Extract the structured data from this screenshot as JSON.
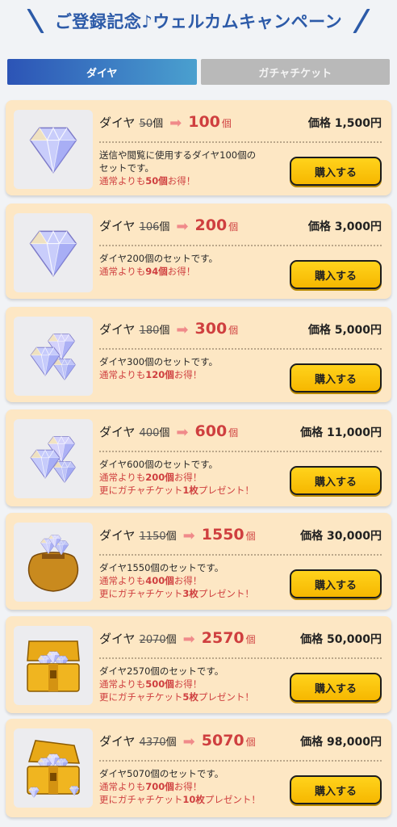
{
  "banner": {
    "title": "ご登録記念♪ウェルカムキャンペーン"
  },
  "tabs": [
    {
      "label": "ダイヤ",
      "active": true
    },
    {
      "label": "ガチャチケット",
      "active": false
    }
  ],
  "colors": {
    "brand_blue": "#2c5aa8",
    "card_bg": "#fde7c4",
    "accent_red": "#cf3f3f",
    "button_yellow": "#ffc80a"
  },
  "products": [
    {
      "item_label": "ダイヤ",
      "old_amount": "50",
      "old_unit": "個",
      "new_amount": "100",
      "new_unit": "個",
      "price": "価格 1,500円",
      "desc_lines": [
        "送信や閲覧に使用するダイヤ100個の",
        "セットです。"
      ],
      "discount_prefix": "通常よりも",
      "discount_value": "50個",
      "discount_suffix": "お得！",
      "bonus_prefix": "",
      "bonus_value": "",
      "bonus_suffix": "",
      "button_label": "購入する",
      "image_icon": "diamond-single-icon"
    },
    {
      "item_label": "ダイヤ",
      "old_amount": "106",
      "old_unit": "個",
      "new_amount": "200",
      "new_unit": "個",
      "price": "価格 3,000円",
      "desc_lines": [
        "ダイヤ200個のセットです。"
      ],
      "discount_prefix": "通常よりも",
      "discount_value": "94個",
      "discount_suffix": "お得！",
      "bonus_prefix": "",
      "bonus_value": "",
      "bonus_suffix": "",
      "button_label": "購入する",
      "image_icon": "diamond-single-icon"
    },
    {
      "item_label": "ダイヤ",
      "old_amount": "180",
      "old_unit": "個",
      "new_amount": "300",
      "new_unit": "個",
      "price": "価格 5,000円",
      "desc_lines": [
        "ダイヤ300個のセットです。"
      ],
      "discount_prefix": "通常よりも",
      "discount_value": "120個",
      "discount_suffix": "お得！",
      "bonus_prefix": "",
      "bonus_value": "",
      "bonus_suffix": "",
      "button_label": "購入する",
      "image_icon": "diamond-pile-icon"
    },
    {
      "item_label": "ダイヤ",
      "old_amount": "400",
      "old_unit": "個",
      "new_amount": "600",
      "new_unit": "個",
      "price": "価格 11,000円",
      "desc_lines": [
        "ダイヤ600個のセットです。"
      ],
      "discount_prefix": "通常よりも",
      "discount_value": "200個",
      "discount_suffix": "お得！",
      "bonus_prefix": "更にガチャチケット",
      "bonus_value": "1枚",
      "bonus_suffix": "プレゼント！",
      "button_label": "購入する",
      "image_icon": "diamond-pile-icon"
    },
    {
      "item_label": "ダイヤ",
      "old_amount": "1150",
      "old_unit": "個",
      "new_amount": "1550",
      "new_unit": "個",
      "price": "価格 30,000円",
      "desc_lines": [
        "ダイヤ1550個のセットです。"
      ],
      "discount_prefix": "通常よりも",
      "discount_value": "400個",
      "discount_suffix": "お得！",
      "bonus_prefix": "更にガチャチケット",
      "bonus_value": "3枚",
      "bonus_suffix": "プレゼント！",
      "button_label": "購入する",
      "image_icon": "diamond-bag-icon"
    },
    {
      "item_label": "ダイヤ",
      "old_amount": "2070",
      "old_unit": "個",
      "new_amount": "2570",
      "new_unit": "個",
      "price": "価格 50,000円",
      "desc_lines": [
        "ダイヤ2570個のセットです。"
      ],
      "discount_prefix": "通常よりも",
      "discount_value": "500個",
      "discount_suffix": "お得！",
      "bonus_prefix": "更にガチャチケット",
      "bonus_value": "5枚",
      "bonus_suffix": "プレゼント！",
      "button_label": "購入する",
      "image_icon": "treasure-chest-icon"
    },
    {
      "item_label": "ダイヤ",
      "old_amount": "4370",
      "old_unit": "個",
      "new_amount": "5070",
      "new_unit": "個",
      "price": "価格 98,000円",
      "desc_lines": [
        "ダイヤ5070個のセットです。"
      ],
      "discount_prefix": "通常よりも",
      "discount_value": "700個",
      "discount_suffix": "お得！",
      "bonus_prefix": "更にガチャチケット",
      "bonus_value": "10枚",
      "bonus_suffix": "プレゼント！",
      "button_label": "購入する",
      "image_icon": "treasure-chest-full-icon"
    }
  ]
}
